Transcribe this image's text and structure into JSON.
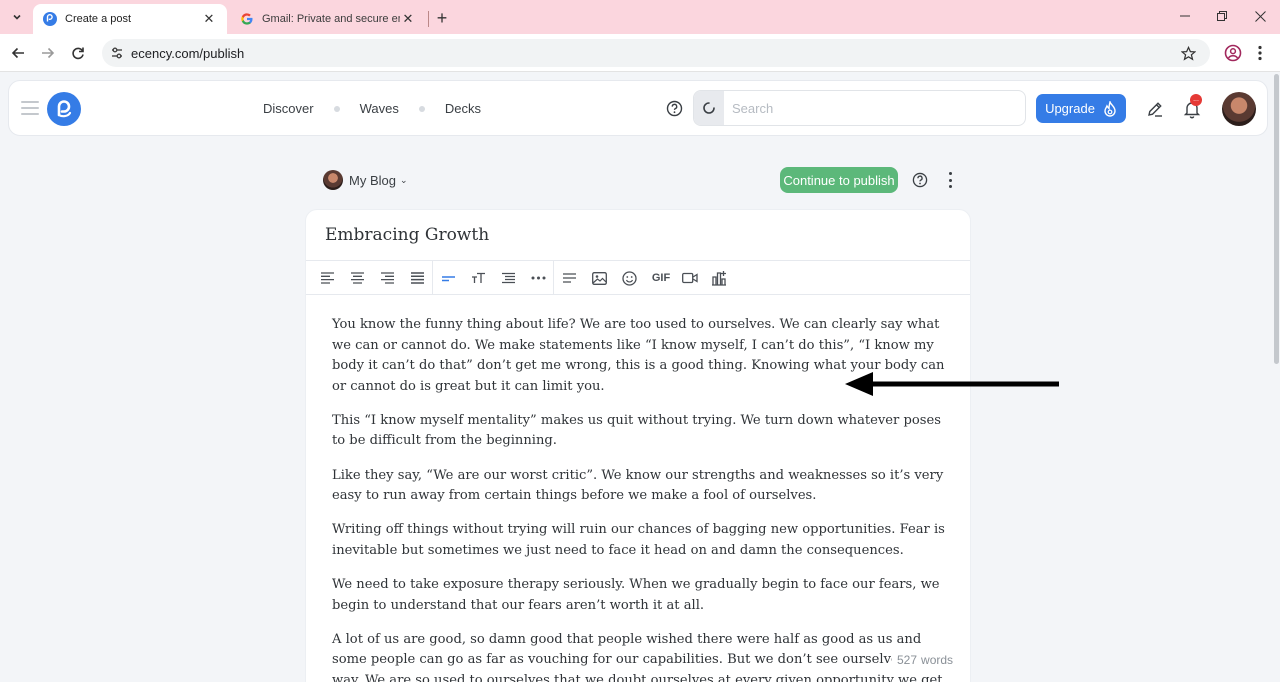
{
  "browser": {
    "tabs": [
      {
        "title": "Create a post",
        "active": true
      },
      {
        "title": "Gmail: Private and secure email",
        "active": false
      }
    ],
    "url": "ecency.com/publish"
  },
  "header": {
    "nav": [
      "Discover",
      "Waves",
      "Decks"
    ],
    "search_placeholder": "Search",
    "upgrade_label": "Upgrade",
    "notification_badge": "...",
    "colors": {
      "brand": "#357ce6",
      "publish": "#5cb87a",
      "badge": "#e53935"
    }
  },
  "editor": {
    "blog_label": "My Blog",
    "publish_label": "Continue to publish",
    "title": "Embracing Growth",
    "toolbar_icons": [
      "align-left-icon",
      "align-center-icon",
      "align-right-icon",
      "align-justify-icon",
      "paragraph-icon",
      "text-size-icon",
      "list-icon",
      "more-icon",
      "text-block-icon",
      "image-icon",
      "emoji-icon",
      "gif-icon",
      "video-icon",
      "poll-icon"
    ],
    "gif_label": "GIF",
    "paragraphs": [
      "You know the funny thing about life? We are too used to ourselves. We can clearly say what we can or cannot do. We make statements like “I know myself, I can’t do this”, “I know my body it can’t do that” don’t get me wrong, this is a good thing. Knowing what your body can or cannot do is great but it can limit you.",
      "This “I know myself mentality” makes us quit without trying. We turn down whatever poses to be difficult from the beginning.",
      "Like they say, “We are our worst critic”. We know our strengths and weaknesses so it’s very easy to run away from certain things before we make a fool of ourselves.",
      "Writing off things without trying will ruin our chances of bagging new opportunities. Fear is inevitable but sometimes we just need to face it head on and damn the consequences.",
      "We need to take exposure therapy seriously. When we gradually begin to face our fears, we begin to understand that our fears aren’t worth it at all.",
      "A lot of us are good, so damn good that people wished there were half as good as us and some people can go as far as vouching for our capabilities. But we don’t see ourselves that way. We are so used to ourselves that we doubt ourselves at every given opportunity we get."
    ],
    "word_count": "527",
    "word_count_unit": "words"
  }
}
